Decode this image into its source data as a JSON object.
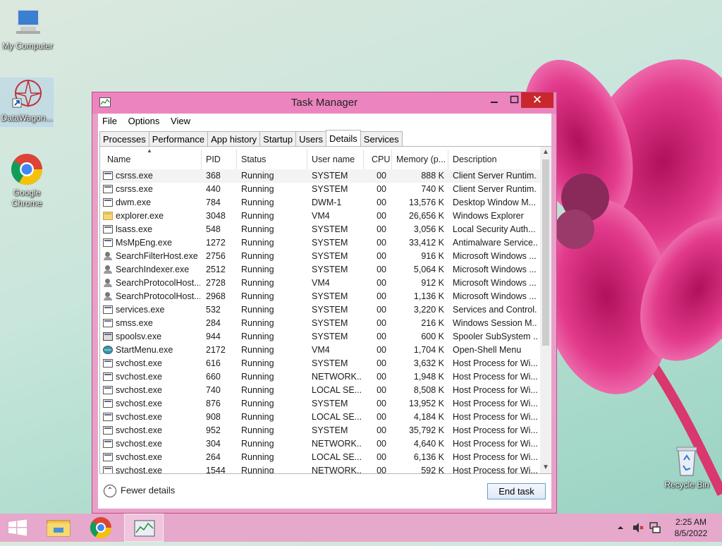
{
  "desktop": {
    "icons": [
      {
        "label": "My Computer"
      },
      {
        "label": "DataWagon..."
      },
      {
        "label": "Google Chrome"
      },
      {
        "label": "Recycle Bin"
      }
    ]
  },
  "window": {
    "title": "Task Manager",
    "close_glyph": "✕",
    "menu": [
      "File",
      "Options",
      "View"
    ],
    "tabs": [
      "Processes",
      "Performance",
      "App history",
      "Startup",
      "Users",
      "Details",
      "Services"
    ],
    "active_tab": "Details",
    "columns": {
      "name": "Name",
      "pid": "PID",
      "status": "Status",
      "user": "User name",
      "cpu": "CPU",
      "memory": "Memory (p...",
      "description": "Description"
    },
    "rows": [
      {
        "icon": "app",
        "name": "csrss.exe",
        "pid": "368",
        "status": "Running",
        "user": "SYSTEM",
        "cpu": "00",
        "memory": "888 K",
        "desc": "Client Server Runtim..."
      },
      {
        "icon": "app",
        "name": "csrss.exe",
        "pid": "440",
        "status": "Running",
        "user": "SYSTEM",
        "cpu": "00",
        "memory": "740 K",
        "desc": "Client Server Runtim..."
      },
      {
        "icon": "app",
        "name": "dwm.exe",
        "pid": "784",
        "status": "Running",
        "user": "DWM-1",
        "cpu": "00",
        "memory": "13,576 K",
        "desc": "Desktop Window M..."
      },
      {
        "icon": "folder",
        "name": "explorer.exe",
        "pid": "3048",
        "status": "Running",
        "user": "VM4",
        "cpu": "00",
        "memory": "26,656 K",
        "desc": "Windows Explorer"
      },
      {
        "icon": "app",
        "name": "lsass.exe",
        "pid": "548",
        "status": "Running",
        "user": "SYSTEM",
        "cpu": "00",
        "memory": "3,056 K",
        "desc": "Local Security Auth..."
      },
      {
        "icon": "app",
        "name": "MsMpEng.exe",
        "pid": "1272",
        "status": "Running",
        "user": "SYSTEM",
        "cpu": "00",
        "memory": "33,412 K",
        "desc": "Antimalware Service..."
      },
      {
        "icon": "person",
        "name": "SearchFilterHost.exe",
        "pid": "2756",
        "status": "Running",
        "user": "SYSTEM",
        "cpu": "00",
        "memory": "916 K",
        "desc": "Microsoft Windows ..."
      },
      {
        "icon": "person",
        "name": "SearchIndexer.exe",
        "pid": "2512",
        "status": "Running",
        "user": "SYSTEM",
        "cpu": "00",
        "memory": "5,064 K",
        "desc": "Microsoft Windows ..."
      },
      {
        "icon": "person",
        "name": "SearchProtocolHost....",
        "pid": "2728",
        "status": "Running",
        "user": "VM4",
        "cpu": "00",
        "memory": "912 K",
        "desc": "Microsoft Windows ..."
      },
      {
        "icon": "person",
        "name": "SearchProtocolHost....",
        "pid": "2968",
        "status": "Running",
        "user": "SYSTEM",
        "cpu": "00",
        "memory": "1,136 K",
        "desc": "Microsoft Windows ..."
      },
      {
        "icon": "app",
        "name": "services.exe",
        "pid": "532",
        "status": "Running",
        "user": "SYSTEM",
        "cpu": "00",
        "memory": "3,220 K",
        "desc": "Services and Control..."
      },
      {
        "icon": "app",
        "name": "smss.exe",
        "pid": "284",
        "status": "Running",
        "user": "SYSTEM",
        "cpu": "00",
        "memory": "216 K",
        "desc": "Windows Session M..."
      },
      {
        "icon": "printer",
        "name": "spoolsv.exe",
        "pid": "944",
        "status": "Running",
        "user": "SYSTEM",
        "cpu": "00",
        "memory": "600 K",
        "desc": "Spooler SubSystem ..."
      },
      {
        "icon": "globe",
        "name": "StartMenu.exe",
        "pid": "2172",
        "status": "Running",
        "user": "VM4",
        "cpu": "00",
        "memory": "1,704 K",
        "desc": "Open-Shell Menu"
      },
      {
        "icon": "app",
        "name": "svchost.exe",
        "pid": "616",
        "status": "Running",
        "user": "SYSTEM",
        "cpu": "00",
        "memory": "3,632 K",
        "desc": "Host Process for Wi..."
      },
      {
        "icon": "app",
        "name": "svchost.exe",
        "pid": "660",
        "status": "Running",
        "user": "NETWORK...",
        "cpu": "00",
        "memory": "1,948 K",
        "desc": "Host Process for Wi..."
      },
      {
        "icon": "app",
        "name": "svchost.exe",
        "pid": "740",
        "status": "Running",
        "user": "LOCAL SE...",
        "cpu": "00",
        "memory": "8,508 K",
        "desc": "Host Process for Wi..."
      },
      {
        "icon": "app",
        "name": "svchost.exe",
        "pid": "876",
        "status": "Running",
        "user": "SYSTEM",
        "cpu": "00",
        "memory": "13,952 K",
        "desc": "Host Process for Wi..."
      },
      {
        "icon": "app",
        "name": "svchost.exe",
        "pid": "908",
        "status": "Running",
        "user": "LOCAL SE...",
        "cpu": "00",
        "memory": "4,184 K",
        "desc": "Host Process for Wi..."
      },
      {
        "icon": "app",
        "name": "svchost.exe",
        "pid": "952",
        "status": "Running",
        "user": "SYSTEM",
        "cpu": "00",
        "memory": "35,792 K",
        "desc": "Host Process for Wi..."
      },
      {
        "icon": "app",
        "name": "svchost.exe",
        "pid": "304",
        "status": "Running",
        "user": "NETWORK...",
        "cpu": "00",
        "memory": "4,640 K",
        "desc": "Host Process for Wi..."
      },
      {
        "icon": "app",
        "name": "svchost.exe",
        "pid": "264",
        "status": "Running",
        "user": "LOCAL SE...",
        "cpu": "00",
        "memory": "6,136 K",
        "desc": "Host Process for Wi..."
      },
      {
        "icon": "app",
        "name": "svchost.exe",
        "pid": "1544",
        "status": "Running",
        "user": "NETWORK...",
        "cpu": "00",
        "memory": "592 K",
        "desc": "Host Process for Wi..."
      }
    ],
    "fewer_details": "Fewer details",
    "end_task": "End task"
  },
  "taskbar": {
    "time": "2:25 AM",
    "date": "8/5/2022",
    "items": [
      "start-icon",
      "file-explorer-icon",
      "chrome-icon",
      "task-manager-icon"
    ]
  },
  "colors": {
    "accent": "#ec84bf",
    "close": "#c7272d",
    "taskbar": "#e6a8cb"
  }
}
